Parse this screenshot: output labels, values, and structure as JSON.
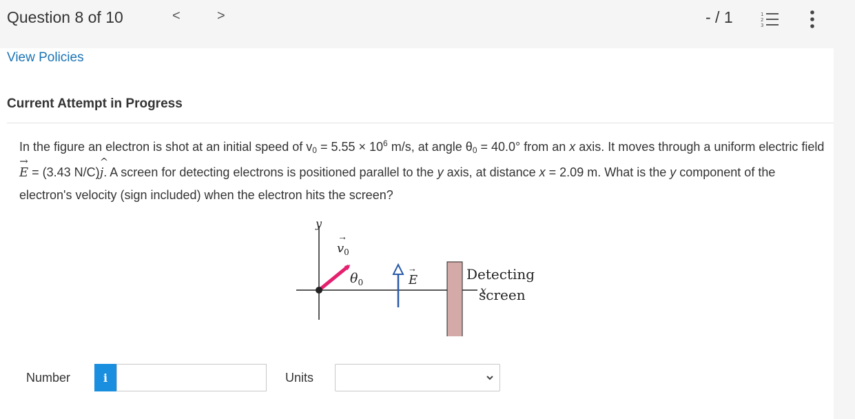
{
  "header": {
    "question_counter": "Question 8 of 10",
    "prev_symbol": "<",
    "next_symbol": ">",
    "score": "- / 1"
  },
  "links": {
    "view_policies": "View Policies"
  },
  "attempt_heading": "Current Attempt in Progress",
  "question": {
    "p1": "In the figure an electron is shot at an initial speed of v",
    "p1_sub": "0",
    "p2": " = 5.55 × 10",
    "p2_sup": "6",
    "p3": " m/s, at angle θ",
    "p3_sub": "0",
    "p4": " = 40.0° from an ",
    "p4_italic": "x",
    "p5": " axis. It moves through a uniform electric field ",
    "field_symbol": "E",
    "p6": " = (3.43 N/C)",
    "unit_vector": "j",
    "p7": ". A screen for detecting electrons is positioned parallel to the ",
    "p7_italic": "y",
    "p8": " axis, at distance ",
    "p8_italic": "x",
    "p9": " = 2.09 m. What is the ",
    "p9_italic": "y",
    "p10": " component of the electron's velocity (sign included) when the electron hits the screen?"
  },
  "figure": {
    "y_axis_label": "y",
    "x_axis_label": "x",
    "velocity_label": "v",
    "velocity_sub": "0",
    "angle_label": "θ",
    "angle_sub": "0",
    "field_label": "E",
    "screen_label_line1": "Detecting",
    "screen_label_line2": "screen",
    "colors": {
      "velocity_arrow": "#e5206e",
      "field_arrow": "#2a5ba8",
      "screen": "#d4aaa8"
    }
  },
  "answer": {
    "number_label": "Number",
    "info_icon_glyph": "i",
    "number_value": "",
    "units_label": "Units",
    "units_selected": ""
  }
}
